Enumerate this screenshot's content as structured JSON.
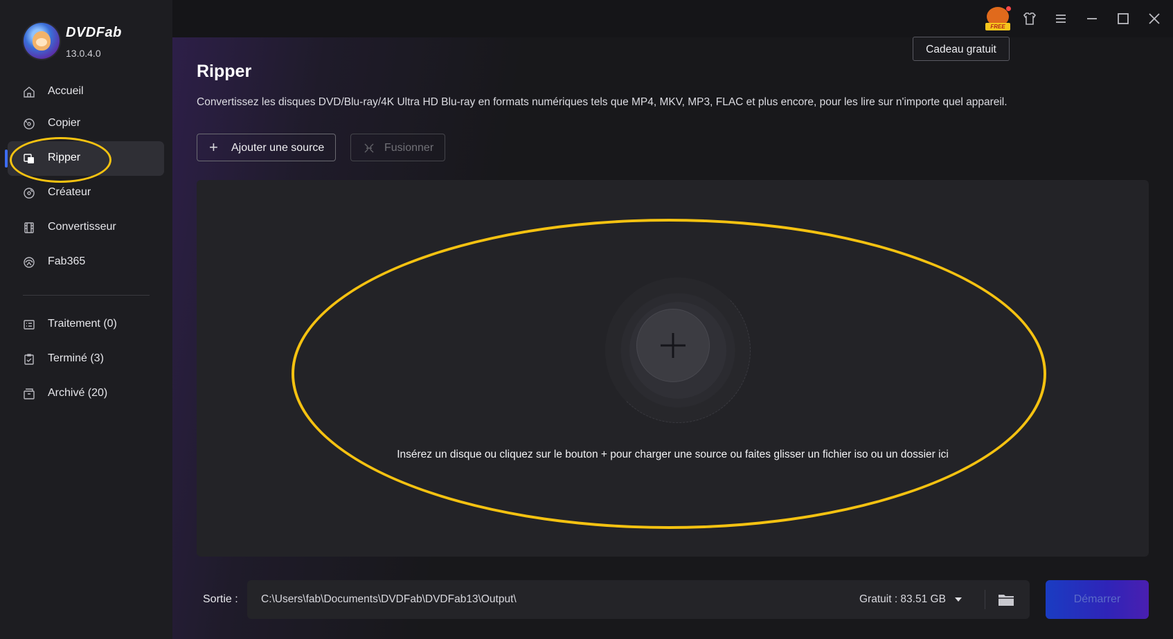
{
  "app": {
    "brand": "DVDFab",
    "version": "13.0.4.0"
  },
  "sidebar": {
    "items": [
      {
        "label": "Accueil",
        "icon": "home-icon"
      },
      {
        "label": "Copier",
        "icon": "copy-disc-icon"
      },
      {
        "label": "Ripper",
        "icon": "ripper-icon",
        "active": true
      },
      {
        "label": "Créateur",
        "icon": "creator-disc-icon"
      },
      {
        "label": "Convertisseur",
        "icon": "film-icon"
      },
      {
        "label": "Fab365",
        "icon": "fab365-icon"
      }
    ],
    "queue": [
      {
        "label": "Traitement (0)",
        "icon": "list-icon"
      },
      {
        "label": "Terminé (3)",
        "icon": "clipboard-check-icon"
      },
      {
        "label": "Archivé (20)",
        "icon": "archive-icon"
      }
    ]
  },
  "topbar": {
    "gift_badge": "FREE",
    "tooltip": "Cadeau gratuit",
    "accent": "#f5c211"
  },
  "main": {
    "title": "Ripper",
    "description": "Convertissez les disques DVD/Blu-ray/4K Ultra HD Blu-ray en formats numériques tels que MP4, MKV, MP3, FLAC et plus encore, pour les lire sur n'importe quel appareil.",
    "add_source": "Ajouter une source",
    "merge": "Fusionner",
    "drop_hint": "Insérez un disque ou cliquez sur le bouton +  pour charger une source ou faites glisser un fichier iso ou un dossier ici"
  },
  "footer": {
    "output_label": "Sortie :",
    "output_path": "C:\\Users\\fab\\Documents\\DVDFab\\DVDFab13\\Output\\",
    "free_space": "Gratuit : 83.51 GB",
    "start": "Démarrer"
  }
}
